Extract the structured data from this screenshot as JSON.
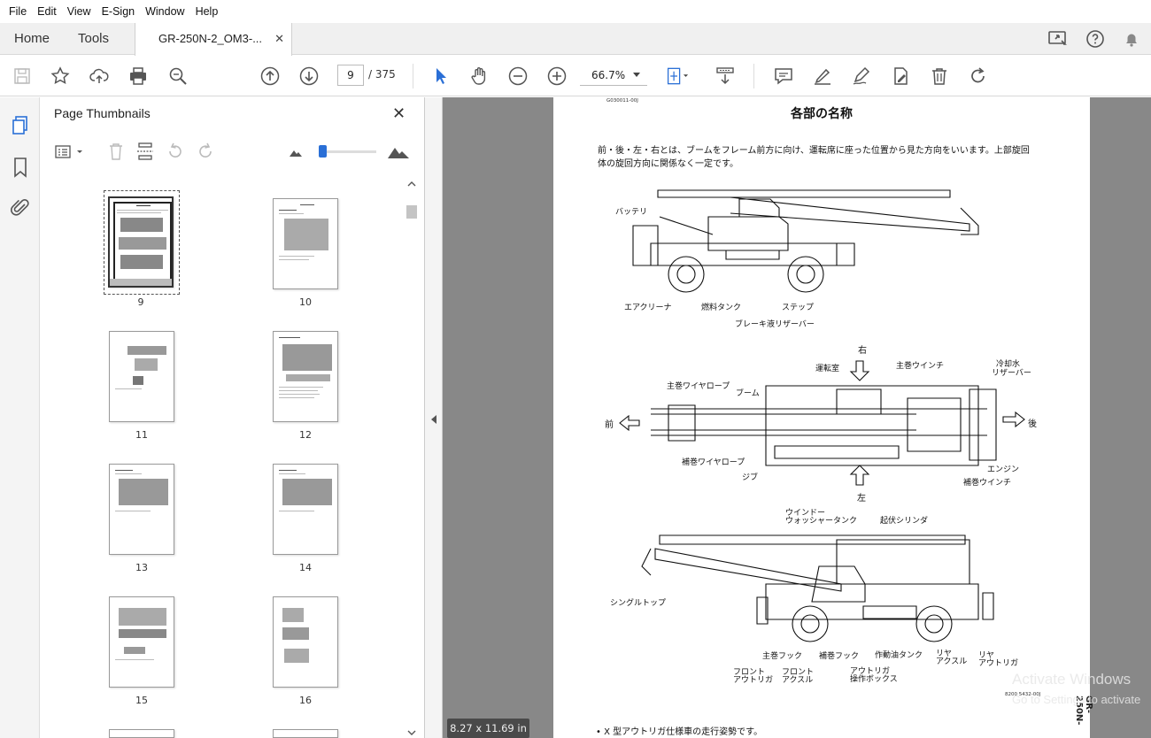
{
  "menu": [
    "File",
    "Edit",
    "View",
    "E-Sign",
    "Window",
    "Help"
  ],
  "tabs": {
    "home": "Home",
    "tools": "Tools",
    "document": "GR-250N-2_OM3-...",
    "close": "✕"
  },
  "toolbar": {
    "page_current": "9",
    "page_total": "/ 375",
    "zoom": "66.7%"
  },
  "panel": {
    "title": "Page Thumbnails",
    "close": "✕",
    "thumbnails": [
      {
        "label": "9"
      },
      {
        "label": "10"
      },
      {
        "label": "11"
      },
      {
        "label": "12"
      },
      {
        "label": "13"
      },
      {
        "label": "14"
      },
      {
        "label": "15"
      },
      {
        "label": "16"
      }
    ]
  },
  "page": {
    "code": "G030011-00J",
    "title": "各部の名称",
    "intro1": "前・後・左・右とは、ブームをフレーム前方に向け、運転席に座った位置から見た方向をいいます。上部旋回",
    "intro2": "体の旋回方向に関係なく一定です。",
    "labels": {
      "battery": "バッテリ",
      "air_cleaner": "エアクリーナ",
      "fuel_tank": "燃料タンク",
      "step": "ステップ",
      "brake_reservoir": "ブレーキ液リザーバー",
      "right": "右",
      "left": "左",
      "front": "前",
      "rear": "後",
      "cab": "運転室",
      "main_winch": "主巻ウインチ",
      "coolant_reservoir1": "冷却水",
      "coolant_reservoir2": "リザーバー",
      "main_wire_rope": "主巻ワイヤロープ",
      "boom": "ブーム",
      "aux_wire_rope": "補巻ワイヤロープ",
      "jib": "ジブ",
      "engine": "エンジン",
      "aux_winch": "補巻ウインチ",
      "washer1": "ウインドー",
      "washer2": "ウォッシャータンク",
      "derrick_cyl": "起伏シリンダ",
      "single_top": "シングルトップ",
      "main_hook": "主巻フック",
      "aux_hook": "補巻フック",
      "hyd_tank": "作動油タンク",
      "front_outrigger1": "フロント",
      "front_outrigger2": "アウトリガ",
      "front_axle1": "フロント",
      "front_axle2": "アクスル",
      "outrigger_box1": "アウトリガ",
      "outrigger_box2": "操作ボックス",
      "rear_axle1": "リヤ",
      "rear_axle2": "アクスル",
      "rear_outrigger1": "リヤ",
      "rear_outrigger2": "アウトリガ"
    },
    "code2": "8200 5432-00J",
    "side_text": "GR-250N-",
    "footer": "• X 型アウトリガ仕様車の走行姿勢です。"
  },
  "page_size": "8.27 x 11.69 in",
  "watermark": {
    "line1": "Activate Windows",
    "line2": "Go to Settings to activate"
  }
}
